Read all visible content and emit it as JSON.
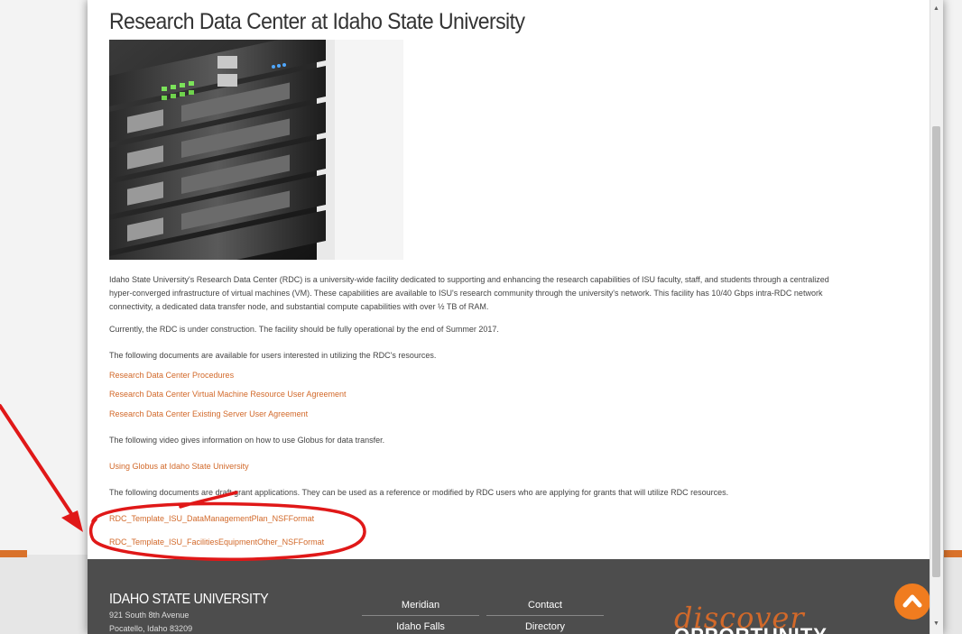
{
  "page": {
    "title": "Research Data Center at Idaho State University",
    "intro": "Idaho State University's Research Data Center (RDC) is a university-wide facility dedicated to supporting and enhancing the research capabilities of ISU faculty, staff, and students through a centralized hyper-converged infrastructure of virtual machines (VM). These capabilities are available to ISU's research community through the university's network.  This facility has 10/40 Gbps intra-RDC network connectivity, a dedicated data transfer node, and substantial compute capabilities with over ½ TB of RAM.",
    "status": "Currently, the RDC is under construction. The facility should be fully operational by the end of Summer 2017.",
    "docs_intro": "The following documents are available for users interested in utilizing the RDC's resources.",
    "docs": [
      "Research Data Center Procedures",
      "Research Data Center Virtual Machine Resource User Agreement",
      "Research Data Center Existing Server User Agreement"
    ],
    "video_intro": "The following video gives information on how to use Globus for data transfer.",
    "video_link": "Using Globus at Idaho State University",
    "grants_intro": "The following documents are draft grant applications. They can be used as a reference or modified by RDC users who are applying for grants that will utilize RDC resources.",
    "grant_docs": [
      "RDC_Template_ISU_DataManagementPlan_NSFFormat",
      "RDC_Template_ISU_FacilitiesEquipmentOther_NSFFormat"
    ]
  },
  "footer": {
    "university": "IDAHO STATE UNIVERSITY",
    "address_line1": "921 South 8th Avenue",
    "address_line2": "Pocatello, Idaho  83209",
    "links_col1": [
      "Meridian",
      "Idaho Falls"
    ],
    "links_col2": [
      "Contact",
      "Directory"
    ],
    "brand_word1": "discover",
    "brand_word2": "OPPORTUNITY"
  },
  "colors": {
    "link": "#d2692a",
    "footer_bg": "#4d4d4d",
    "accent": "#f07c1f",
    "annotation": "#e01818"
  },
  "icons": {
    "back_to_top": "chevron-up-icon",
    "annotation_arrow": "arrow-icon"
  }
}
